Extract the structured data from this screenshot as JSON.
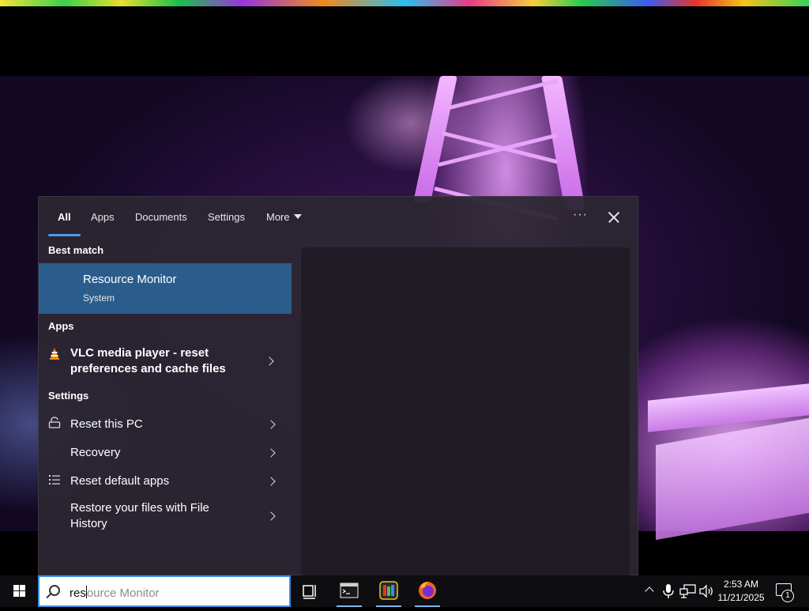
{
  "search_panel": {
    "tabs": [
      {
        "label": "All",
        "active": true
      },
      {
        "label": "Apps"
      },
      {
        "label": "Documents"
      },
      {
        "label": "Settings"
      },
      {
        "label": "More"
      }
    ],
    "more_options": "···",
    "best_match": {
      "header": "Best match",
      "title": "Resource Monitor",
      "subtitle": "System"
    },
    "apps": {
      "header": "Apps",
      "items": [
        {
          "label": "VLC media player - reset preferences and cache files",
          "icon": "vlc-cone-icon"
        }
      ]
    },
    "settings": {
      "header": "Settings",
      "items": [
        {
          "label": "Reset this PC",
          "icon": "reset-pc-icon"
        },
        {
          "label": "Recovery",
          "icon": "recovery-icon"
        },
        {
          "label": "Reset default apps",
          "icon": "default-apps-icon"
        },
        {
          "label": "Restore your files with File History",
          "icon": "file-history-icon"
        }
      ]
    }
  },
  "taskbar": {
    "search": {
      "typed": "res",
      "suggestion": "ource Monitor"
    },
    "apps": [
      {
        "name": "task-view",
        "icon": "task-view-icon"
      },
      {
        "name": "terminal",
        "icon": "terminal-icon"
      },
      {
        "name": "paint-app",
        "icon": "paint-app-icon"
      },
      {
        "name": "firefox",
        "icon": "firefox-icon"
      }
    ],
    "clock": {
      "time": "2:53 AM",
      "date": "11/21/2025"
    },
    "notifications": {
      "count": "1"
    }
  },
  "colors": {
    "accent": "#4c9be8",
    "selection": "#2b5d8c",
    "panel_bg": "#2c2632"
  }
}
